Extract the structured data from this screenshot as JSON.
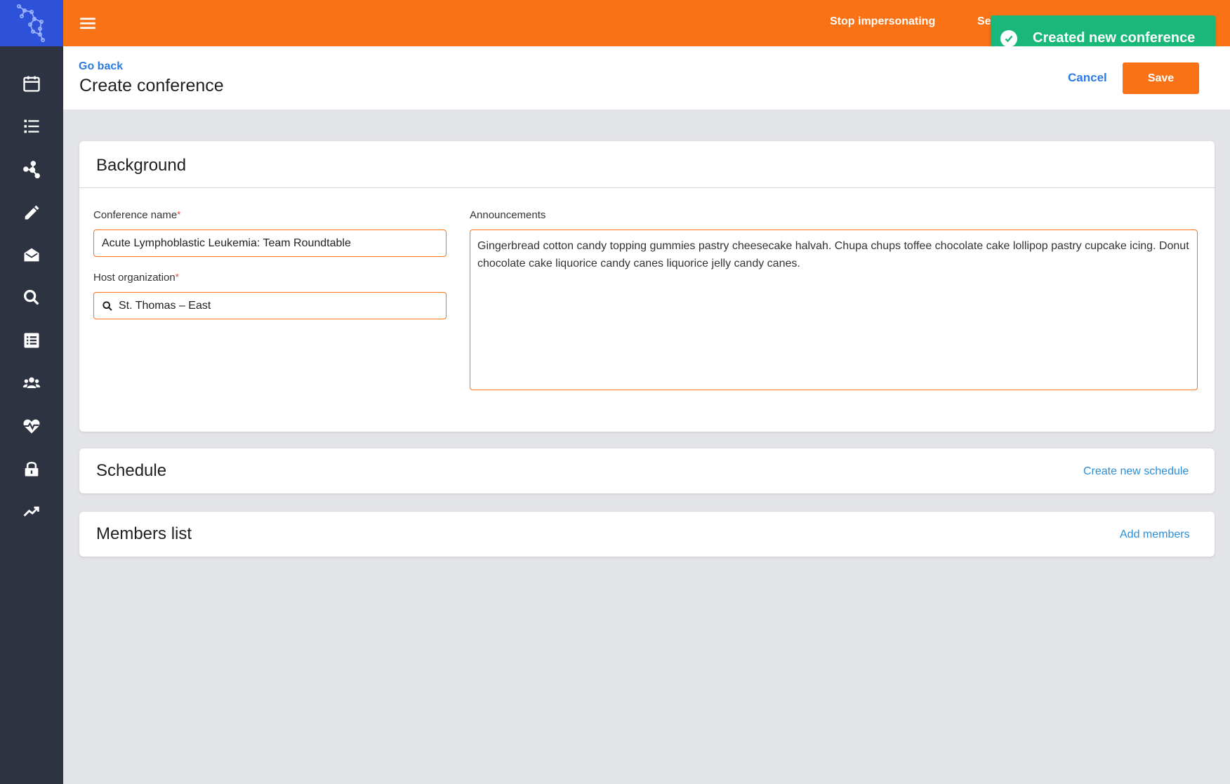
{
  "colors": {
    "brand": "#f97316",
    "sidebar": "#2d3340",
    "logo_bg": "#2d52d9",
    "link": "#2a7be4",
    "success": "#19b77a"
  },
  "sidebar": {
    "logo_icon": "molecule-logo",
    "items": [
      {
        "icon": "calendar-icon"
      },
      {
        "icon": "list-icon"
      },
      {
        "icon": "network-icon"
      },
      {
        "icon": "pencil-icon"
      },
      {
        "icon": "mail-open-icon"
      },
      {
        "icon": "search-icon"
      },
      {
        "icon": "document-list-icon"
      },
      {
        "icon": "users-icon"
      },
      {
        "icon": "heart-pulse-icon"
      },
      {
        "icon": "lock-icon"
      },
      {
        "icon": "trending-up-icon"
      }
    ]
  },
  "topbar": {
    "menu_icon": "hamburger-icon",
    "stop_impersonating": "Stop impersonating",
    "truncated_link": "Se"
  },
  "toast": {
    "icon": "check-circle-icon",
    "message": "Created new conference"
  },
  "header": {
    "go_back": "Go back",
    "title": "Create conference",
    "cancel": "Cancel",
    "save": "Save"
  },
  "background": {
    "title": "Background",
    "conference_name_label": "Conference name",
    "conference_name_value": "Acute Lymphoblastic Leukemia: Team Roundtable",
    "host_org_label": "Host organization",
    "host_org_value": "St. Thomas – East",
    "announcements_label": "Announcements",
    "announcements_value": "Gingerbread cotton candy topping gummies pastry cheesecake halvah. Chupa chups toffee chocolate cake lollipop pastry cupcake icing. Donut chocolate cake liquorice candy canes liquorice jelly candy canes.",
    "required_mark": "*"
  },
  "schedule": {
    "title": "Schedule",
    "action": "Create new schedule"
  },
  "members": {
    "title": "Members list",
    "action": "Add members"
  }
}
